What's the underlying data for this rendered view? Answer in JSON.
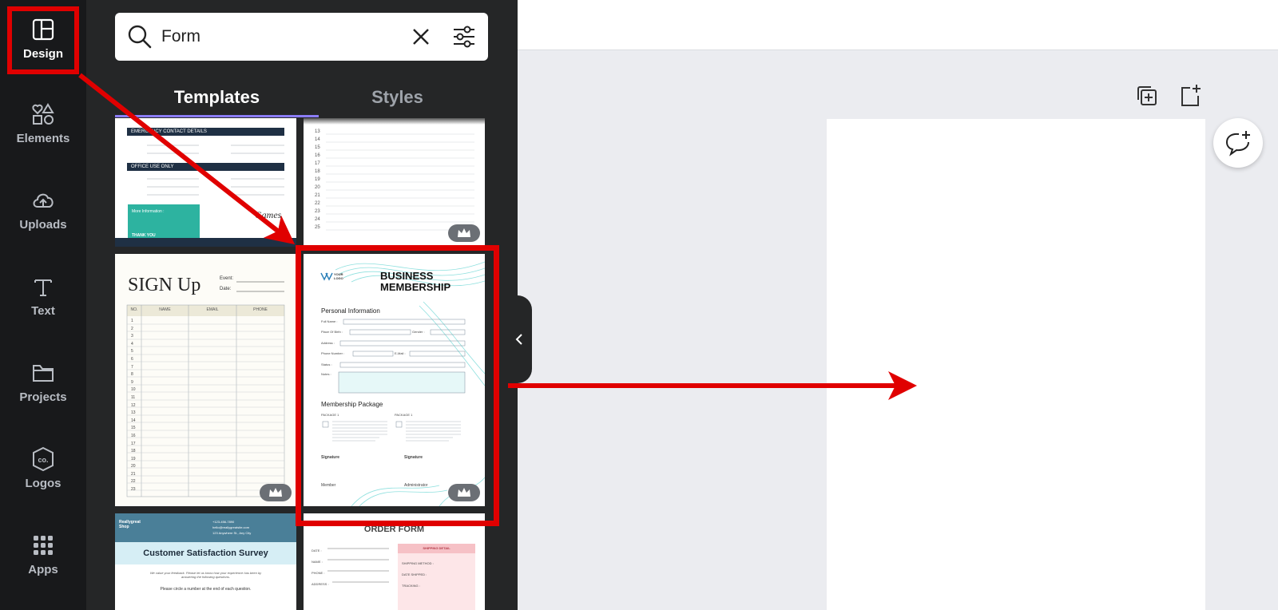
{
  "rail": {
    "items": [
      {
        "label": "Design",
        "icon": "layout-icon"
      },
      {
        "label": "Elements",
        "icon": "shapes-icon"
      },
      {
        "label": "Uploads",
        "icon": "cloud-upload-icon"
      },
      {
        "label": "Text",
        "icon": "text-icon"
      },
      {
        "label": "Projects",
        "icon": "folder-icon"
      },
      {
        "label": "Logos",
        "icon": "logo-badge-icon"
      },
      {
        "label": "Apps",
        "icon": "grid-icon"
      }
    ]
  },
  "search": {
    "value": "Form"
  },
  "tabs": [
    {
      "label": "Templates"
    },
    {
      "label": "Styles"
    }
  ],
  "templates": {
    "emergency": {
      "heading1": "EMERGENCY CONTACT DETAILS",
      "heading2": "OFFICE USE ONLY",
      "contact_label": "More Information :",
      "thanks": "THANK YOU"
    },
    "signup": {
      "title": "SIGN Up",
      "event_label": "Event:",
      "date_label": "Date:",
      "columns": [
        "NO.",
        "NAME",
        "EMAIL",
        "PHONE"
      ],
      "rows": [
        "1",
        "2",
        "3",
        "4",
        "5",
        "6",
        "7",
        "8",
        "9",
        "10",
        "11",
        "12",
        "13",
        "14",
        "15",
        "16",
        "17",
        "18",
        "19",
        "20",
        "21",
        "22",
        "23"
      ]
    },
    "business": {
      "logo": "YOUR LOGO",
      "title_line1": "BUSINESS",
      "title_line2": "MEMBERSHIP",
      "section1": "Personal Information",
      "fields": [
        "Full Name :",
        "Place Of Birth :",
        "Gender :",
        "Address :",
        "Phone Number :",
        "E-Mail :",
        "Status :",
        "Notes :"
      ],
      "section2": "Membership Package",
      "package1": "PACKAGE 1",
      "package2": "PACKAGE 1",
      "sig1": "Signature",
      "sig2": "Signature",
      "member": "Member",
      "admin": "Administrator"
    },
    "survey": {
      "shop": "Reallygreat Shop",
      "phone": "+123-456-7890",
      "email": "hello@reallygreatsite.com",
      "address": "123 Anywhere St., Any City",
      "title": "Customer Satisfaction Survey",
      "note": "We value your feedback. Please let us know how your experience has been by answering the following questions.",
      "instruction": "Please circle a number at the end of each question."
    },
    "order": {
      "title": "ORDER FORM",
      "fields": [
        "DATE :",
        "NAME :",
        "PHONE :",
        "ADDRESS :"
      ],
      "shipping_header": "SHIPPING DETAIL",
      "shipping_fields": [
        "SHIPPING METHOD :",
        "DATE SHIPPED :",
        "TRACKING :"
      ]
    },
    "numbers": {
      "rows": [
        "13",
        "14",
        "15",
        "16",
        "17",
        "18",
        "19",
        "20",
        "21",
        "22",
        "23",
        "24",
        "25"
      ]
    }
  },
  "colors": {
    "rail_bg": "#18191b",
    "panel_bg": "#252627",
    "accent": "#8b7cf6",
    "highlight": "#e00000",
    "teal": "#2db3a0"
  }
}
